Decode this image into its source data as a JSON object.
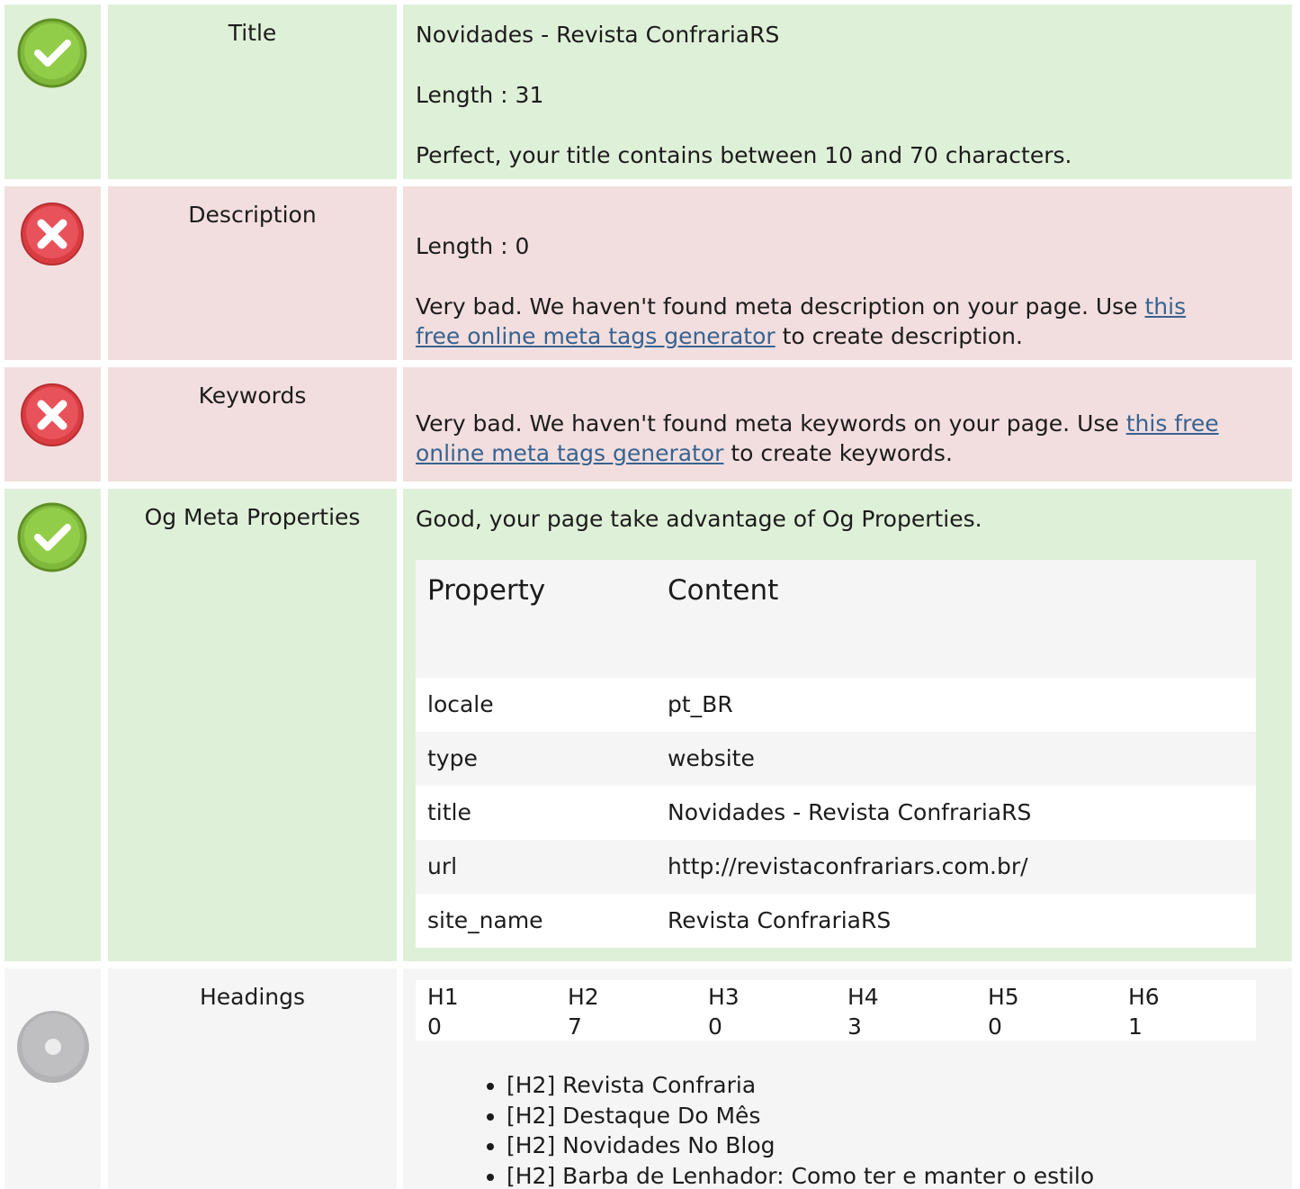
{
  "rows": {
    "title": {
      "label": "Title",
      "status": "good",
      "status_icon": "check-circle-icon",
      "value": "Novidades - Revista ConfrariaRS",
      "length": "Length : 31",
      "message": "Perfect, your title contains between 10 and 70 characters."
    },
    "description": {
      "label": "Description",
      "status": "bad",
      "status_icon": "error-circle-icon",
      "length": "Length : 0",
      "message_pre": "Very bad. We haven't found meta description on your page. Use ",
      "link_a": "this",
      "link_b": "free online meta tags generator",
      "message_post": " to create description."
    },
    "keywords": {
      "label": "Keywords",
      "status": "bad",
      "status_icon": "error-circle-icon",
      "message_pre": "Very bad. We haven't found meta keywords on your page. Use ",
      "link_a": "this free",
      "link_b": "online meta tags generator",
      "message_post": " to create keywords."
    },
    "og": {
      "label": "Og Meta Properties",
      "status": "good",
      "status_icon": "check-circle-icon",
      "message": "Good, your page take advantage of Og Properties.",
      "table": {
        "headers": [
          "Property",
          "Content"
        ],
        "rows": [
          [
            "locale",
            "pt_BR"
          ],
          [
            "type",
            "website"
          ],
          [
            "title",
            "Novidades - Revista ConfrariaRS"
          ],
          [
            "url",
            "http://revistaconfrariars.com.br/"
          ],
          [
            "site_name",
            "Revista ConfrariaRS"
          ]
        ]
      }
    },
    "headings": {
      "label": "Headings",
      "status": "info",
      "status_icon": "neutral-circle-icon",
      "counts": [
        {
          "tag": "H1",
          "count": "0"
        },
        {
          "tag": "H2",
          "count": "7"
        },
        {
          "tag": "H3",
          "count": "0"
        },
        {
          "tag": "H4",
          "count": "3"
        },
        {
          "tag": "H5",
          "count": "0"
        },
        {
          "tag": "H6",
          "count": "1"
        }
      ],
      "list": [
        "[H2] Revista Confraria",
        "[H2] Destaque Do Mês",
        "[H2] Novidades No Blog",
        "[H2] Barba de Lenhador: Como ter e manter o estilo"
      ]
    }
  },
  "colors": {
    "good_bg": "#dff0d8",
    "bad_bg": "#f2dede",
    "info_bg": "#f5f5f5",
    "link": "#376391",
    "good_icon": "#8cc63f",
    "bad_icon": "#e0474c",
    "neutral_icon": "#b3b3b5"
  }
}
